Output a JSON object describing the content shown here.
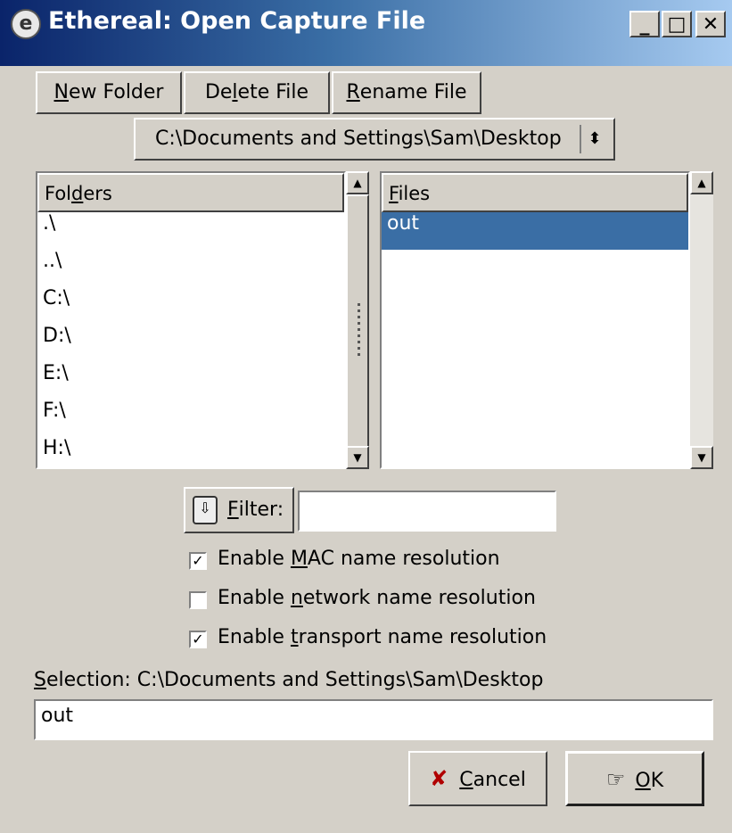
{
  "window": {
    "title": "Ethereal: Open Capture File",
    "app_icon": "e-logo-icon",
    "controls": {
      "minimize": "_",
      "maximize": "□",
      "close": "✕"
    }
  },
  "toolbar": {
    "new_folder_pre": "",
    "new_folder_u": "N",
    "new_folder_post": "ew Folder",
    "delete_file_pre": "De",
    "delete_file_u": "l",
    "delete_file_post": "ete File",
    "rename_file_pre": "",
    "rename_file_u": "R",
    "rename_file_post": "ename File"
  },
  "path_selector": {
    "value": "C:\\Documents and Settings\\Sam\\Desktop",
    "arrow": "⬍"
  },
  "folders": {
    "header_pre": "Fol",
    "header_u": "d",
    "header_post": "ers",
    "items": [
      ".\\",
      "..\\",
      "C:\\",
      "D:\\",
      "E:\\",
      "F:\\",
      "H:\\"
    ]
  },
  "files": {
    "header_pre": "",
    "header_u": "F",
    "header_post": "iles",
    "items": [
      "out"
    ],
    "selected_index": 0
  },
  "filter": {
    "icon": "filter-icon",
    "label_pre": "",
    "label_u": "F",
    "label_post": "ilter:",
    "value": ""
  },
  "options": [
    {
      "pre": "Enable ",
      "u": "M",
      "post": "AC name resolution",
      "checked": true
    },
    {
      "pre": "Enable ",
      "u": "n",
      "post": "etwork name resolution",
      "checked": false
    },
    {
      "pre": "Enable ",
      "u": "t",
      "post": "ransport name resolution",
      "checked": true
    }
  ],
  "selection": {
    "label_u": "S",
    "label_post": "election: C:\\Documents and Settings\\Sam\\Desktop",
    "value": "out"
  },
  "buttons": {
    "cancel_u": "C",
    "cancel_post": "ancel",
    "cancel_icon": "x-cancel-icon",
    "ok_u": "O",
    "ok_post": "K",
    "ok_icon": "ok-hand-icon"
  },
  "colors": {
    "titlebar_start": "#0a246a",
    "titlebar_end": "#a6caf0",
    "selection_highlight": "#3a6ea5",
    "cancel_icon_color": "#b00000"
  }
}
